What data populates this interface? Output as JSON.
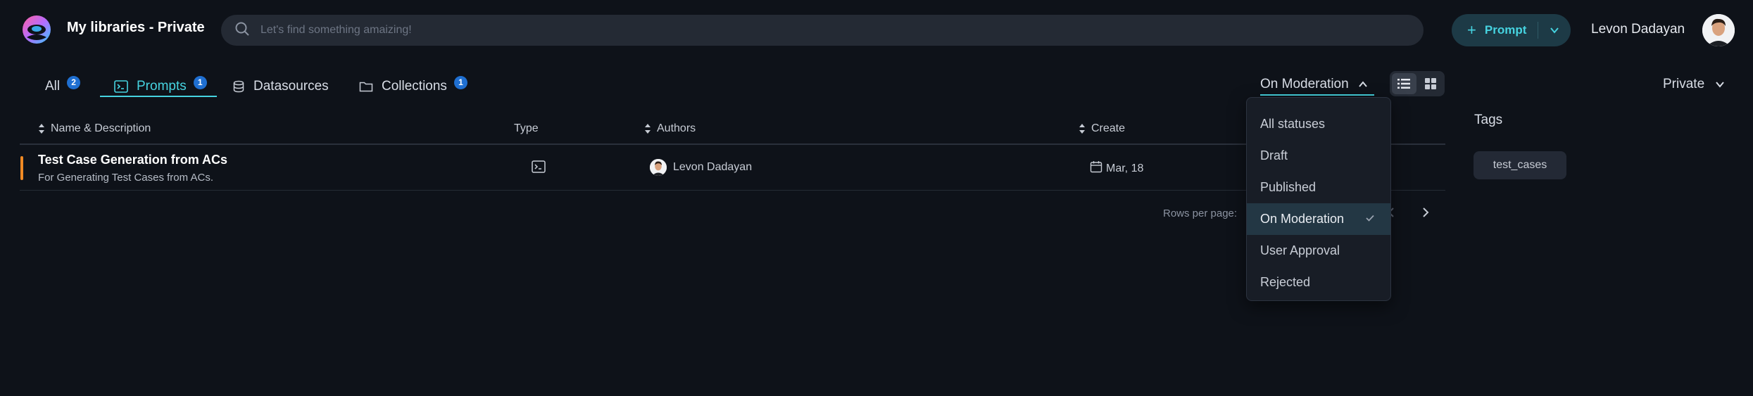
{
  "header": {
    "app_title": "My libraries - Private",
    "search_placeholder": "Let's find something amaizing!",
    "prompt_button_label": "Prompt",
    "user_name": "Levon Dadayan",
    "icons": [
      "logo-icon",
      "search-icon",
      "plus-icon",
      "chevron-down-icon",
      "avatar"
    ]
  },
  "tabs": [
    {
      "label": "All",
      "badge": "2",
      "active": false
    },
    {
      "label": "Prompts",
      "badge": "1",
      "active": true,
      "icon": "terminal-icon"
    },
    {
      "label": "Datasources",
      "badge": "",
      "active": false,
      "icon": "database-icon"
    },
    {
      "label": "Collections",
      "badge": "1",
      "active": false,
      "icon": "folder-icon"
    }
  ],
  "filters": {
    "status_selected": "On Moderation",
    "visibility": "Private",
    "view_mode": "list"
  },
  "table": {
    "columns": [
      "Name & Description",
      "Type",
      "Authors",
      "Create"
    ],
    "rows": [
      {
        "title": "Test Case Generation from ACs",
        "description": "For Generating Test Cases from ACs.",
        "type_icon": "terminal-icon",
        "author": "Levon Dadayan",
        "created": "Mar, 18"
      }
    ],
    "rows_per_page_label": "Rows per page:"
  },
  "tags": {
    "heading": "Tags",
    "items": [
      "test_cases"
    ]
  },
  "status_dropdown": {
    "options": [
      "All statuses",
      "Draft",
      "Published",
      "On Moderation",
      "User Approval",
      "Rejected"
    ],
    "selected": "On Moderation"
  },
  "colors": {
    "background": "#0e1219",
    "accent": "#46d3e0",
    "badge": "#1f6fd1",
    "row_marker": "#f08a24"
  }
}
